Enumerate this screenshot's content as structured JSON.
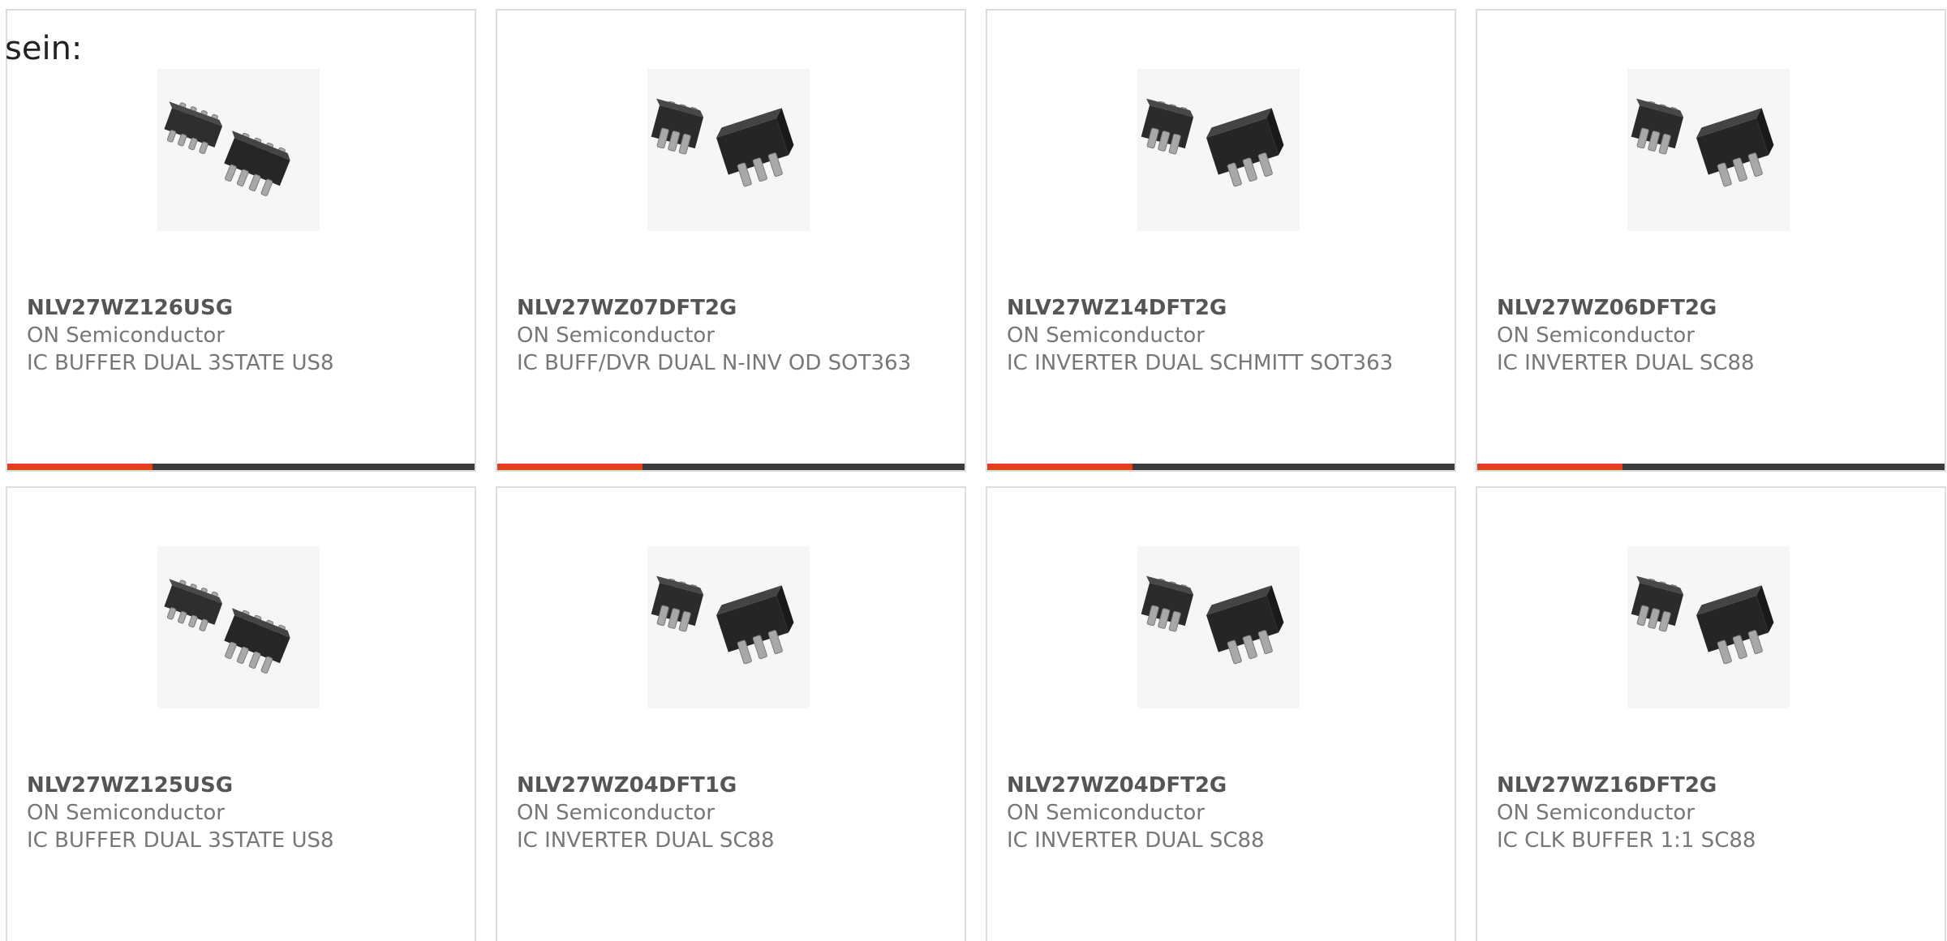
{
  "intro_text": "sein:",
  "colors": {
    "accent": "#e0401a",
    "bar": "#3c3c3c"
  },
  "products": [
    {
      "part": "NLV27WZ126USG",
      "manufacturer": "ON Semiconductor",
      "description": "IC BUFFER DUAL 3STATE US8",
      "package_icon": "us8-package-icon",
      "progress": 0.31
    },
    {
      "part": "NLV27WZ07DFT2G",
      "manufacturer": "ON Semiconductor",
      "description": "IC BUFF/DVR DUAL N-INV OD SOT363",
      "package_icon": "sot363-package-icon",
      "progress": 0.31
    },
    {
      "part": "NLV27WZ14DFT2G",
      "manufacturer": "ON Semiconductor",
      "description": "IC INVERTER DUAL SCHMITT SOT363",
      "package_icon": "sot363-package-icon",
      "progress": 0.31
    },
    {
      "part": "NLV27WZ06DFT2G",
      "manufacturer": "ON Semiconductor",
      "description": "IC INVERTER DUAL SC88",
      "package_icon": "sot363-package-icon",
      "progress": 0.31
    },
    {
      "part": "NLV27WZ125USG",
      "manufacturer": "ON Semiconductor",
      "description": "IC BUFFER DUAL 3STATE US8",
      "package_icon": "us8-package-icon"
    },
    {
      "part": "NLV27WZ04DFT1G",
      "manufacturer": "ON Semiconductor",
      "description": "IC INVERTER DUAL SC88",
      "package_icon": "sot363-package-icon"
    },
    {
      "part": "NLV27WZ04DFT2G",
      "manufacturer": "ON Semiconductor",
      "description": "IC INVERTER DUAL SC88",
      "package_icon": "sot363-package-icon"
    },
    {
      "part": "NLV27WZ16DFT2G",
      "manufacturer": "ON Semiconductor",
      "description": "IC CLK BUFFER 1:1 SC88",
      "package_icon": "sot363-package-icon"
    }
  ]
}
